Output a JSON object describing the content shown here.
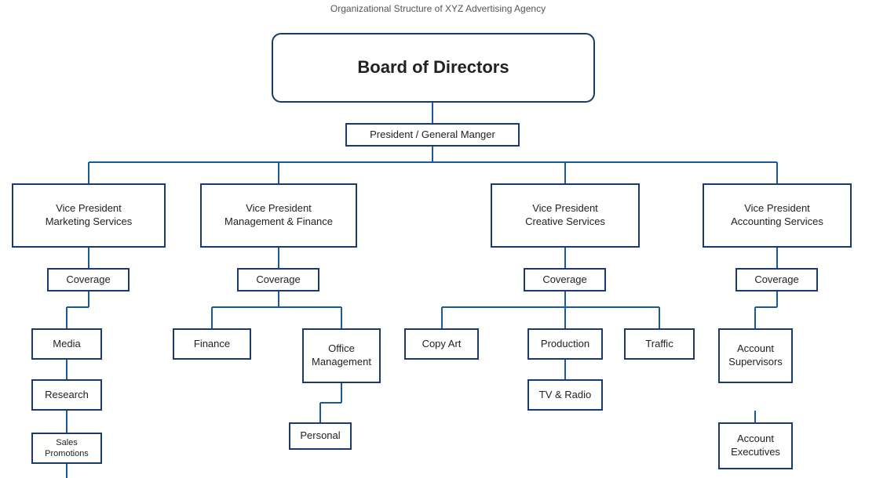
{
  "page": {
    "title": "Organizational Structure of XYZ Advertising Agency"
  },
  "boxes": {
    "board": "Board of Directors",
    "president": "President / General Manger",
    "vp_marketing": "Vice President\nMarketing Services",
    "vp_management": "Vice President\nManagement & Finance",
    "vp_creative": "Vice President\nCreative Services",
    "vp_accounting": "Vice President\nAccounting Services",
    "coverage_marketing": "Coverage",
    "coverage_management": "Coverage",
    "coverage_creative": "Coverage",
    "coverage_accounting": "Coverage",
    "media": "Media",
    "research": "Research",
    "sales_promotions": "Sales Promotions",
    "finance": "Finance",
    "office_management": "Office\nManagement",
    "personal": "Personal",
    "copy_art": "Copy Art",
    "production": "Production",
    "traffic": "Traffic",
    "tv_radio": "TV & Radio",
    "account_supervisors": "Account\nSupervisors",
    "account_executives": "Account\nExecutives"
  }
}
